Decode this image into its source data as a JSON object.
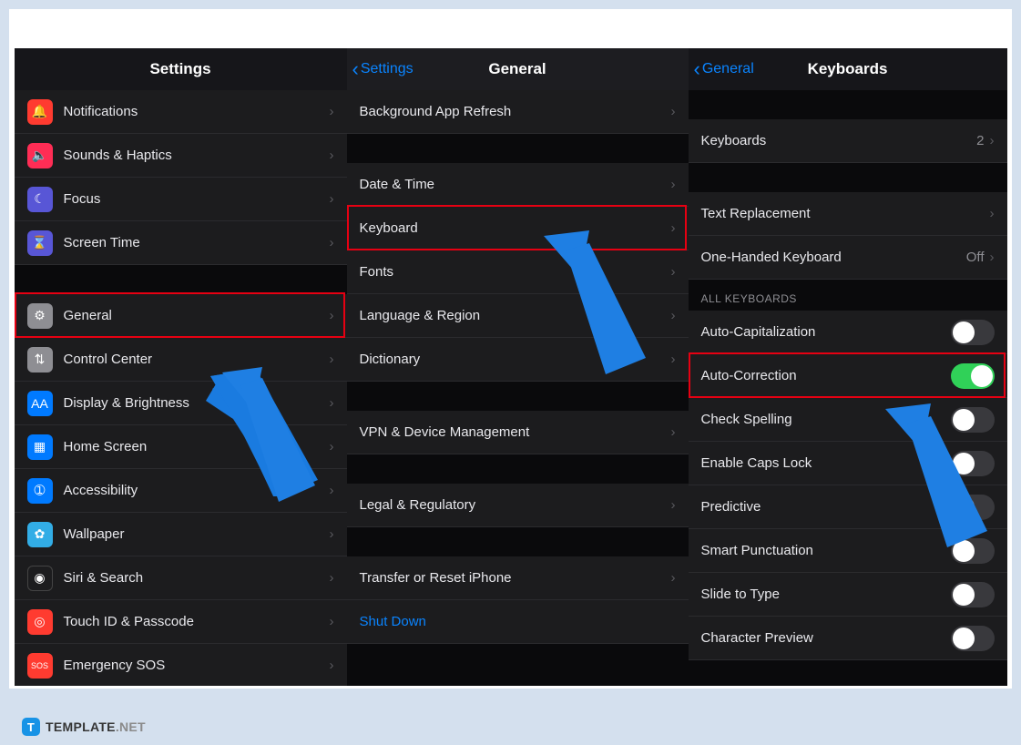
{
  "panel1": {
    "title": "Settings",
    "items_group1": [
      {
        "icon": "bell-icon",
        "color": "ic-red",
        "glyph": "🔔",
        "label": "Notifications"
      },
      {
        "icon": "speaker-icon",
        "color": "ic-pink",
        "glyph": "🔈",
        "label": "Sounds & Haptics"
      },
      {
        "icon": "moon-icon",
        "color": "ic-indigo",
        "glyph": "☾",
        "label": "Focus"
      },
      {
        "icon": "hourglass-icon",
        "color": "ic-indigo",
        "glyph": "⌛",
        "label": "Screen Time"
      }
    ],
    "items_group2": [
      {
        "icon": "gear-icon",
        "color": "ic-gray",
        "glyph": "⚙",
        "label": "General"
      },
      {
        "icon": "switches-icon",
        "color": "ic-gray",
        "glyph": "⇅",
        "label": "Control Center"
      },
      {
        "icon": "aa-icon",
        "color": "ic-blue",
        "glyph": "AA",
        "label": "Display & Brightness"
      },
      {
        "icon": "grid-icon",
        "color": "ic-blue",
        "glyph": "▦",
        "label": "Home Screen"
      },
      {
        "icon": "person-icon",
        "color": "ic-blue",
        "glyph": "➀",
        "label": "Accessibility"
      },
      {
        "icon": "flower-icon",
        "color": "ic-cyan",
        "glyph": "✿",
        "label": "Wallpaper"
      },
      {
        "icon": "siri-icon",
        "color": "ic-black",
        "glyph": "◉",
        "label": "Siri & Search"
      },
      {
        "icon": "fingerprint-icon",
        "color": "ic-red",
        "glyph": "◎",
        "label": "Touch ID & Passcode"
      },
      {
        "icon": "sos-icon",
        "color": "ic-red",
        "glyph": "SOS",
        "label": "Emergency SOS"
      }
    ]
  },
  "panel2": {
    "back": "Settings",
    "title": "General",
    "group1": [
      {
        "label": "Background App Refresh"
      }
    ],
    "group2": [
      {
        "label": "Date & Time"
      },
      {
        "label": "Keyboard"
      },
      {
        "label": "Fonts"
      },
      {
        "label": "Language & Region"
      },
      {
        "label": "Dictionary"
      }
    ],
    "group3": [
      {
        "label": "VPN & Device Management"
      }
    ],
    "group4": [
      {
        "label": "Legal & Regulatory"
      }
    ],
    "group5": [
      {
        "label": "Transfer or Reset iPhone"
      },
      {
        "label": "Shut Down",
        "blue": true
      }
    ]
  },
  "panel3": {
    "back": "General",
    "title": "Keyboards",
    "group1": [
      {
        "label": "Keyboards",
        "value": "2"
      }
    ],
    "group2": [
      {
        "label": "Text Replacement"
      },
      {
        "label": "One-Handed Keyboard",
        "value": "Off"
      }
    ],
    "section_label": "ALL KEYBOARDS",
    "toggles": [
      {
        "label": "Auto-Capitalization",
        "on": false
      },
      {
        "label": "Auto-Correction",
        "on": true
      },
      {
        "label": "Check Spelling",
        "on": false
      },
      {
        "label": "Enable Caps Lock",
        "on": false
      },
      {
        "label": "Predictive",
        "on": false
      },
      {
        "label": "Smart Punctuation",
        "on": false
      },
      {
        "label": "Slide to Type",
        "on": false
      },
      {
        "label": "Character Preview",
        "on": false
      }
    ]
  },
  "watermark": {
    "brand": "TEMPLATE",
    "suffix": ".NET",
    "badge": "T"
  },
  "highlights": {
    "h1": "General row",
    "h2": "Keyboard row",
    "h3": "Auto-Correction row"
  }
}
